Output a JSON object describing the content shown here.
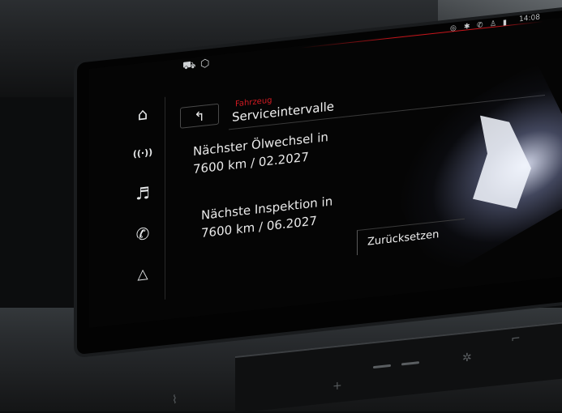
{
  "status": {
    "time": "14:08",
    "left_icons": [
      "car-service-icon",
      "cube-icon"
    ],
    "right_icons": [
      "location-icon",
      "bluetooth-icon",
      "phone-icon",
      "person-icon",
      "signal-icon"
    ]
  },
  "sidebar": {
    "items": [
      {
        "name": "home",
        "glyph": "⌂"
      },
      {
        "name": "radio",
        "glyph": "((·))"
      },
      {
        "name": "media",
        "glyph": "♬"
      },
      {
        "name": "phone",
        "glyph": "✆"
      },
      {
        "name": "navigation",
        "glyph": "▲"
      }
    ]
  },
  "header": {
    "breadcrumb": "Fahrzeug",
    "title": "Serviceintervalle",
    "back_glyph": "↰"
  },
  "service": {
    "oil_label": "Nächster Ölwechsel in",
    "oil_value": "7600 km / 02.2027",
    "inspection_label": "Nächste Inspektion in",
    "inspection_value": "7600 km / 06.2027"
  },
  "actions": {
    "reset_label": "Zurücksetzen"
  },
  "colors": {
    "accent": "#d11a22",
    "text": "#f1f1f1",
    "screen_bg": "#050505"
  }
}
